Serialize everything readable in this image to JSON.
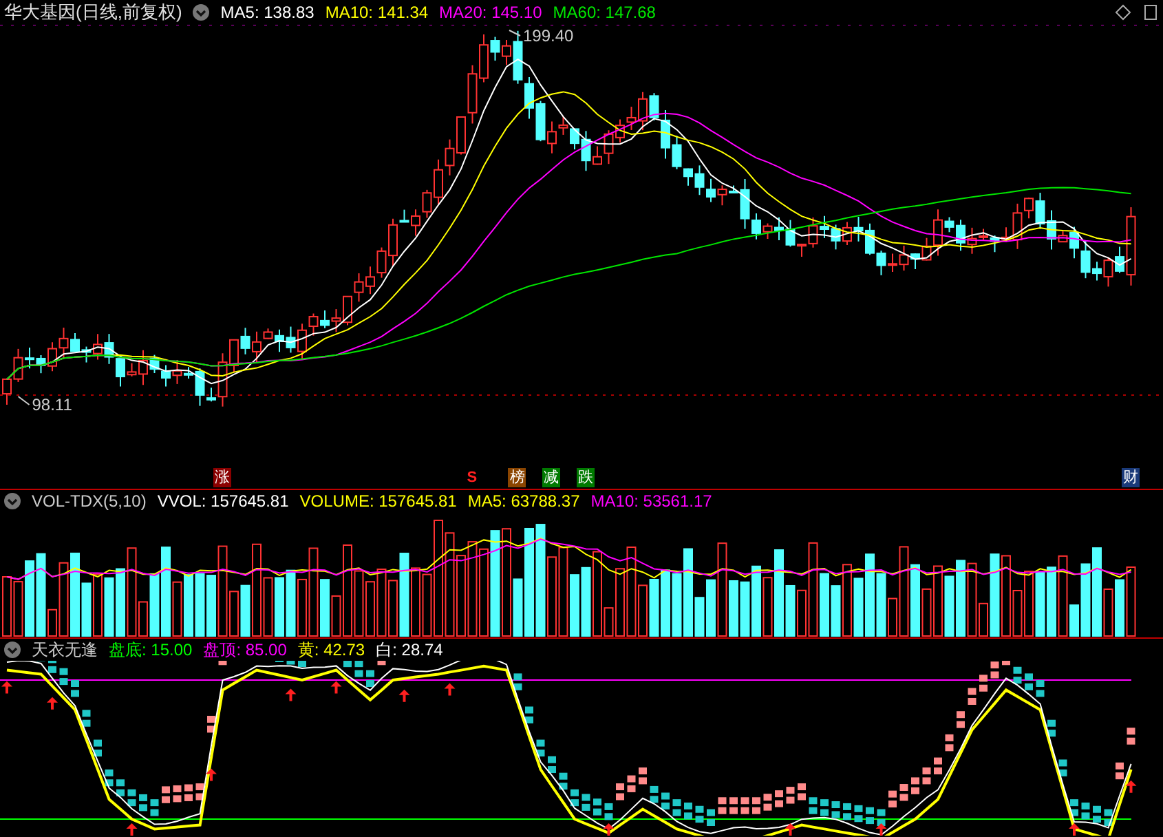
{
  "header": {
    "title": "华大基因(日线,前复权)",
    "items": [
      {
        "label": "MA5:",
        "value": "138.83",
        "color": "#ffffff"
      },
      {
        "label": "MA10:",
        "value": "141.34",
        "color": "#ffff00"
      },
      {
        "label": "MA20:",
        "value": "145.10",
        "color": "#ff00ff"
      },
      {
        "label": "MA60:",
        "value": "147.68",
        "color": "#00e600"
      }
    ]
  },
  "price_chart": {
    "high_label": "199.40",
    "low_label": "98.11",
    "markers": [
      {
        "text": "涨",
        "color": "#8b0000",
        "kind": "badge"
      },
      {
        "text": "S",
        "color": "#ff2020",
        "kind": "plain"
      },
      {
        "text": "榜",
        "color": "#8b4500",
        "kind": "badge"
      },
      {
        "text": "减",
        "color": "#007a00",
        "kind": "badge"
      },
      {
        "text": "跌",
        "color": "#007a00",
        "kind": "badge"
      },
      {
        "text": "财",
        "color": "#1a3a7a",
        "kind": "badge"
      }
    ]
  },
  "volume_panel": {
    "name": "VOL-TDX(5,10)",
    "items": [
      {
        "label": "VVOL:",
        "value": "157645.81",
        "color": "#ffffff"
      },
      {
        "label": "VOLUME:",
        "value": "157645.81",
        "color": "#ffff00"
      },
      {
        "label": "MA5:",
        "value": "63788.37",
        "color": "#ffff00"
      },
      {
        "label": "MA10:",
        "value": "53561.17",
        "color": "#ff00ff"
      }
    ]
  },
  "indicator_panel": {
    "name": "天衣无逢",
    "items": [
      {
        "label": "盘底:",
        "value": "15.00",
        "color": "#00ff00"
      },
      {
        "label": "盘顶:",
        "value": "85.00",
        "color": "#ff00ff"
      },
      {
        "label": "黄:",
        "value": "42.73",
        "color": "#ffff00"
      },
      {
        "label": "白:",
        "value": "28.74",
        "color": "#ffffff"
      }
    ]
  }
}
